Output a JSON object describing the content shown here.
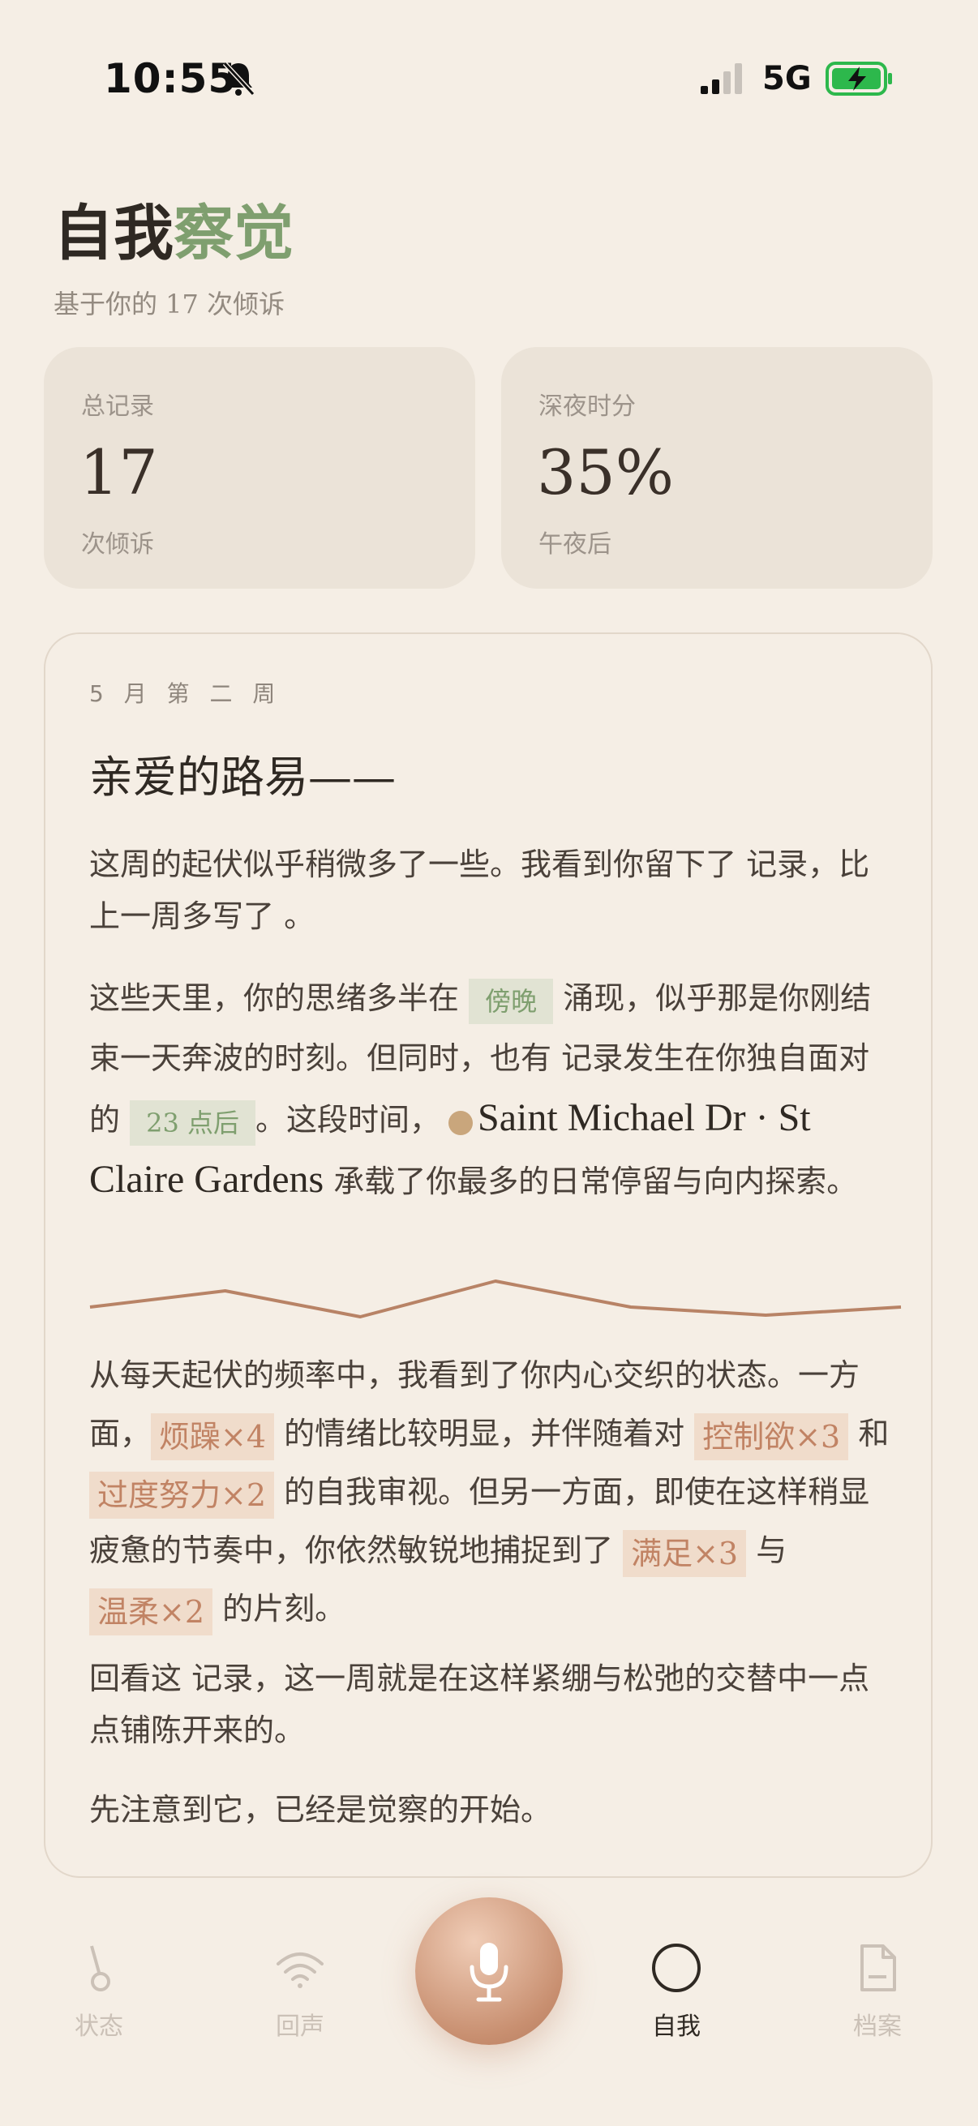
{
  "status_bar": {
    "time": "10:55",
    "network": "5G"
  },
  "header": {
    "title_main": "自我",
    "title_accent": "察觉",
    "subtitle": "基于你的 17 次倾诉"
  },
  "stats": [
    {
      "label": "总记录",
      "value": "17",
      "unit": "次倾诉"
    },
    {
      "label": "深夜时分",
      "value": "35%",
      "unit": "午夜后"
    }
  ],
  "letter": {
    "week": "5 月 第 二 周",
    "greeting": "亲爱的路易——",
    "p1": "这周的起伏似乎稍微多了一些。我看到你留下了  记录，比上一周多写了 。",
    "p2": {
      "a": "这些天里，你的思绪多半在 ",
      "tag1": "傍晚",
      "b": " 涌现，似乎那是你刚结束一天奔波的时刻。但同时，也有  记录发生在你独自面对的 ",
      "tag2": "23  点后",
      "c": "。这段时间，",
      "location": "Saint Michael Dr · St Claire Gardens",
      "d": " 承载了你最多的日常停留与向内探索。"
    },
    "p3": {
      "a": "从每天起伏的频率中，我看到了你内心交织的状态。一方面，",
      "tag1": "烦躁×4",
      "b": " 的情绪比较明显，并伴随着对 ",
      "tag2": "控制欲×3",
      "c": " 和 ",
      "tag3": "过度努力×2",
      "d": " 的自我审视。但另一方面，即使在这样稍显疲惫的节奏中，你依然敏锐地捕捉到了 ",
      "tag4": "满足×3",
      "e": " 与 ",
      "tag5": "温柔×2",
      "f": " 的片刻。"
    },
    "p4": "回看这  记录，这一周就是在这样紧绷与松弛的交替中一点点铺陈开来的。",
    "p5": "先注意到它，已经是觉察的开始。"
  },
  "wave_chart": {
    "values": [
      0,
      1,
      -0.6,
      1.6,
      0,
      -0.5,
      0
    ]
  },
  "nav": {
    "items": [
      {
        "label": "状态",
        "icon": "pendulum-icon"
      },
      {
        "label": "回声",
        "icon": "wifi-icon"
      },
      {
        "label": "自我",
        "icon": "moon-icon"
      },
      {
        "label": "档案",
        "icon": "document-icon"
      }
    ],
    "mic_icon": "microphone-icon"
  },
  "colors": {
    "accent_green": "#7f9f6f",
    "accent_orange": "#c18364",
    "background": "#f5eee5"
  }
}
